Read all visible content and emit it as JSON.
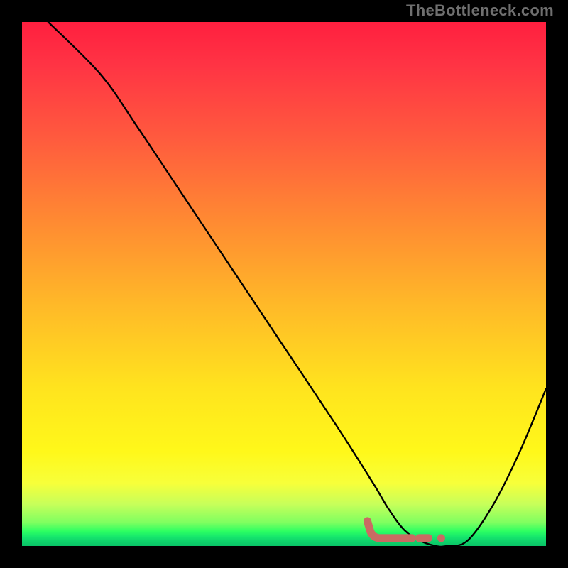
{
  "watermark": "TheBottleneck.com",
  "chart_data": {
    "type": "line",
    "title": "",
    "xlabel": "",
    "ylabel": "",
    "xlim": [
      0,
      100
    ],
    "ylim": [
      0,
      100
    ],
    "series": [
      {
        "name": "bottleneck-curve",
        "x": [
          5,
          15,
          22,
          30,
          40,
          50,
          60,
          67,
          70,
          73,
          76,
          79,
          81,
          85,
          90,
          95,
          100
        ],
        "values": [
          100,
          90,
          80,
          68,
          53,
          38,
          23,
          12,
          7,
          3,
          1,
          0,
          0,
          1,
          8,
          18,
          30
        ]
      }
    ],
    "optimal_marker": {
      "name": "optimal-zone-marker",
      "x_start": 67,
      "x_end": 82,
      "y": 1.5,
      "color": "#c96b63"
    },
    "gradient_stops": [
      {
        "pos": 0,
        "color": "#ff1f3f"
      },
      {
        "pos": 50,
        "color": "#ffc224"
      },
      {
        "pos": 80,
        "color": "#fff81a"
      },
      {
        "pos": 100,
        "color": "#09c266"
      }
    ]
  }
}
